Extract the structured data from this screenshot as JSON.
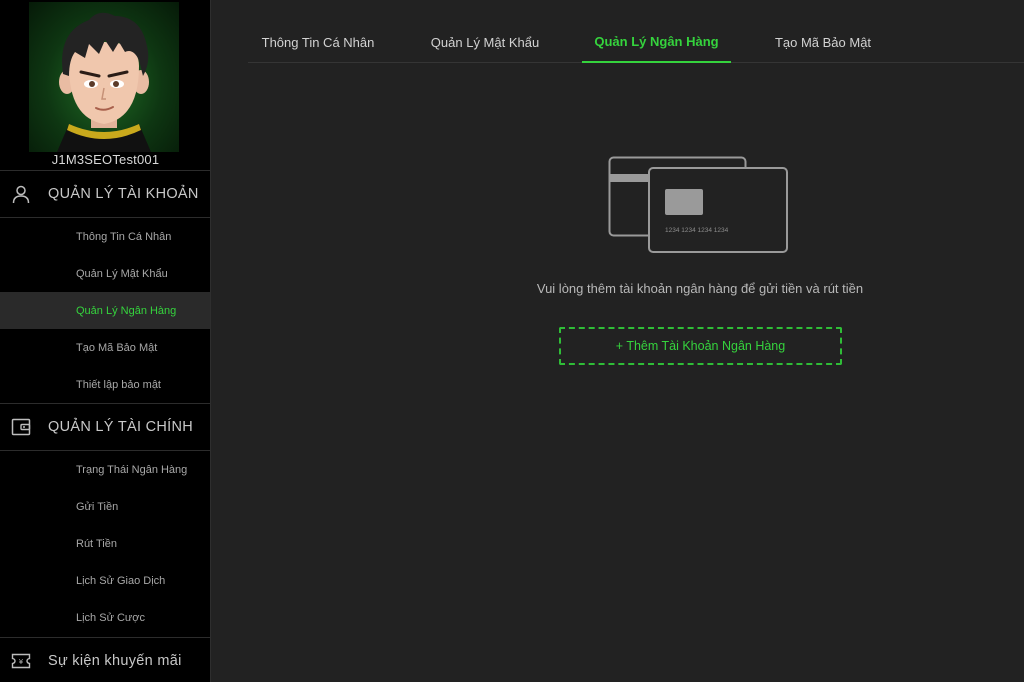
{
  "user": {
    "username": "J1M3SEOTest001"
  },
  "sidebar": {
    "account_section": {
      "label": "QUẢN LÝ TÀI KHOẢN",
      "icon": "user-icon",
      "items": [
        {
          "label": "Thông Tin Cá Nhân"
        },
        {
          "label": "Quản Lý Mật Khẩu"
        },
        {
          "label": "Quản Lý Ngân Hàng",
          "active": true
        },
        {
          "label": "Tạo Mã Bảo Mật"
        },
        {
          "label": "Thiết lập bảo mật"
        }
      ]
    },
    "finance_section": {
      "label": "QUẢN LÝ TÀI CHÍNH",
      "icon": "wallet-icon",
      "items": [
        {
          "label": "Trạng Thái Ngân Hàng"
        },
        {
          "label": "Gửi Tiền"
        },
        {
          "label": "Rút Tiền"
        },
        {
          "label": "Lịch Sử Giao Dịch"
        },
        {
          "label": "Lịch Sử Cược"
        }
      ]
    },
    "promo_section": {
      "label": "Sự kiện khuyến mãi",
      "icon": "ticket-icon"
    }
  },
  "tabs": [
    {
      "label": "Thông Tin Cá Nhân"
    },
    {
      "label": "Quản Lý Mật Khẩu"
    },
    {
      "label": "Quản Lý Ngân Hàng",
      "active": true
    },
    {
      "label": "Tạo Mã Bảo Mật"
    }
  ],
  "bank": {
    "card_number": "1234 1234 1234 1234",
    "empty_message": "Vui lòng thêm tài khoản ngân hàng để gửi tiền và rút tiền",
    "add_button": "+ Thêm Tài Khoản Ngân Hàng"
  },
  "colors": {
    "accent": "#35d33d",
    "background": "#222222",
    "sidebar": "#000000"
  }
}
